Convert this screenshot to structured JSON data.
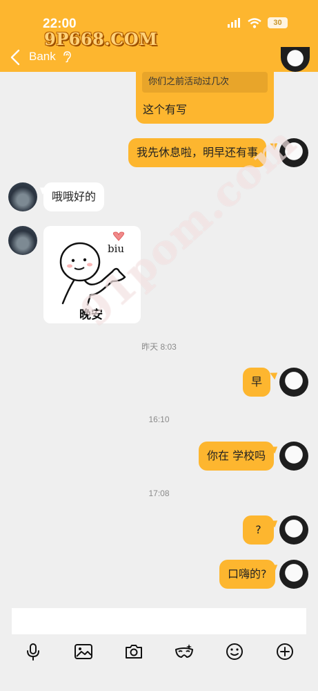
{
  "status_bar": {
    "time": "22:00",
    "battery": "30",
    "signal_icon": "signal-icon",
    "wifi_icon": "wifi-icon"
  },
  "watermark": {
    "top": "9P668.COM",
    "diagonal": "91pom.com"
  },
  "header": {
    "title": "Bank",
    "back_icon": "chevron-left-icon",
    "ear_icon": "ear-icon",
    "menu_icon": "menu-icon"
  },
  "messages": [
    {
      "side": "right",
      "quote": "你们之前活动过几次",
      "text": "这个有写"
    },
    {
      "side": "right",
      "text": "我先休息啦，明早还有事"
    },
    {
      "side": "left",
      "text": "哦哦好的"
    },
    {
      "side": "left",
      "sticker": {
        "label": "晚安",
        "caption": "biu"
      }
    },
    {
      "timestamp": "昨天 8:03"
    },
    {
      "side": "right",
      "text": "早"
    },
    {
      "timestamp": "16:10"
    },
    {
      "side": "right",
      "text": "你在 学校吗"
    },
    {
      "timestamp": "17:08"
    },
    {
      "side": "right",
      "text": "?"
    },
    {
      "side": "right",
      "text": "口嗨的?"
    }
  ],
  "input": {
    "placeholder": "",
    "value": ""
  },
  "toolbar": {
    "icons": [
      "microphone-icon",
      "image-icon",
      "camera-icon",
      "mask-icon",
      "emoji-icon",
      "plus-icon"
    ]
  },
  "colors": {
    "accent": "#fdb62f",
    "background": "#efefef",
    "bubble_other": "#ffffff",
    "text": "#222222"
  }
}
